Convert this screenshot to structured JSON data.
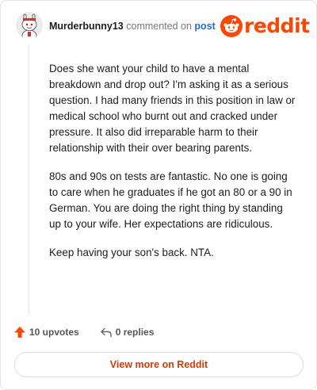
{
  "comment": {
    "username": "Murderbunny13",
    "action_text": "commented on",
    "post_link": "post",
    "paragraphs": [
      "Does she want your child to have a mental breakdown and drop out? I'm asking it as a serious question. I had many friends in this position in law or medical school who burnt out and cracked under pressure. It also did irreparable harm to their relationship with their over bearing parents.",
      "80s and 90s on tests are fantastic. No one is going to care when he graduates if he got an 80 or a 90 in German. You are doing the right thing by standing up to your wife. Her expectations are ridiculous.",
      "Keep having your son's back. NTA."
    ]
  },
  "brand": {
    "logo_text": "reddit",
    "color": "#ff4500"
  },
  "stats": {
    "upvotes": "10 upvotes",
    "replies": "0 replies"
  },
  "footer": {
    "view_more": "View more on Reddit"
  },
  "icons": {
    "avatar": "snoo-avatar-icon",
    "logo": "reddit-snoo-logo-icon",
    "upvote": "upvote-arrow-icon",
    "reply": "reply-arrow-icon"
  }
}
